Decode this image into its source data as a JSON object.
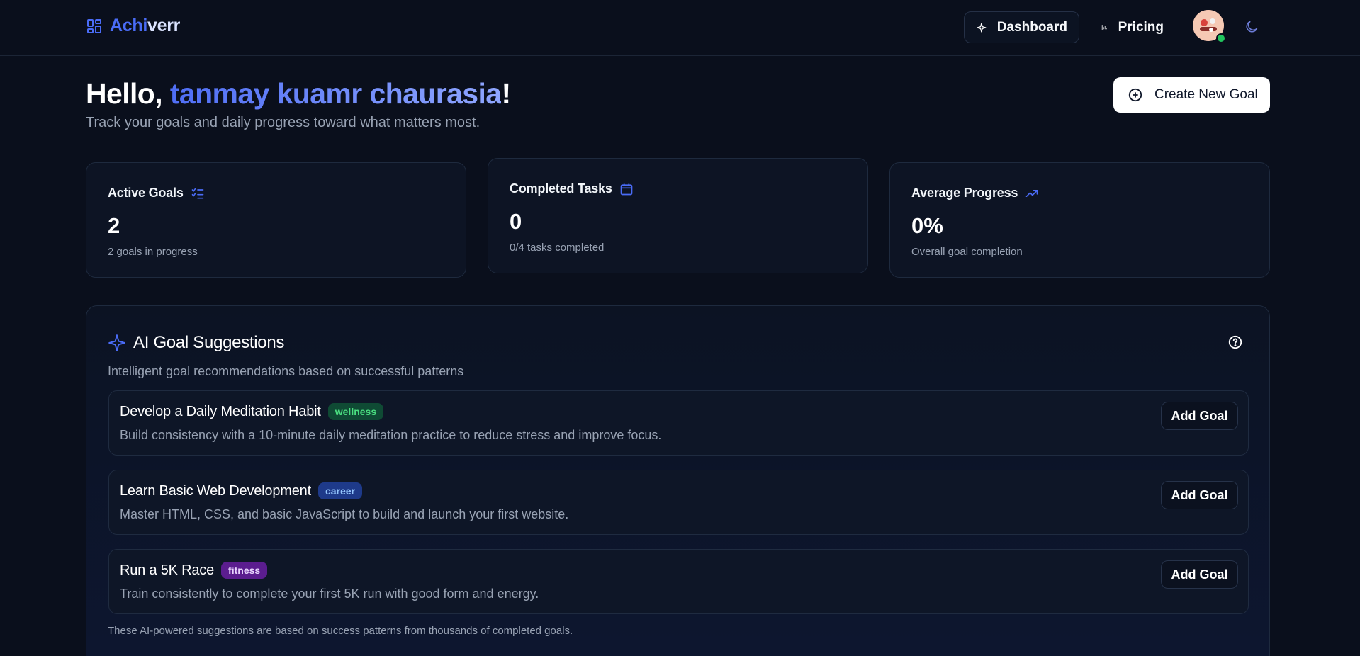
{
  "brand": {
    "name_part1": "Achi",
    "name_part2": "verr"
  },
  "nav": {
    "dashboard_label": "Dashboard",
    "pricing_label": "Pricing"
  },
  "icons": {
    "brand": "grid-layout-icon",
    "dashboard": "sparkle-icon",
    "pricing": "bar-chart-icon",
    "theme": "moon-icon",
    "create": "plus-circle-icon",
    "active_goals": "list-checks-icon",
    "completed_tasks": "calendar-icon",
    "average_progress": "trending-up-icon",
    "ai": "sparkle-icon",
    "help": "help-circle-icon"
  },
  "greeting": {
    "prefix": "Hello, ",
    "name": "tanmay kuamr chaurasia",
    "suffix": "!"
  },
  "subtitle": "Track your goals and daily progress toward what matters most.",
  "create_button_label": "Create New Goal",
  "stats": [
    {
      "title": "Active Goals",
      "value": "2",
      "desc": "2 goals in progress"
    },
    {
      "title": "Completed Tasks",
      "value": "0",
      "desc": "0/4 tasks completed"
    },
    {
      "title": "Average Progress",
      "value": "0%",
      "desc": "Overall goal completion"
    }
  ],
  "ai": {
    "title": "AI Goal Suggestions",
    "subtitle": "Intelligent goal recommendations based on successful patterns",
    "footer": "These AI-powered suggestions are based on success patterns from thousands of completed goals.",
    "suggestions": [
      {
        "title": "Develop a Daily Meditation Habit",
        "tag": "wellness",
        "desc": "Build consistency with a 10-minute daily meditation practice to reduce stress and improve focus.",
        "button": "Add Goal"
      },
      {
        "title": "Learn Basic Web Development",
        "tag": "career",
        "desc": "Master HTML, CSS, and basic JavaScript to build and launch your first website.",
        "button": "Add Goal"
      },
      {
        "title": "Run a 5K Race",
        "tag": "fitness",
        "desc": "Train consistently to complete your first 5K run with good form and energy.",
        "button": "Add Goal"
      }
    ]
  },
  "colors": {
    "background": "#0a0f1c",
    "accent": "#4a6cf7",
    "wellness": "#4ade80",
    "career": "#93c5fd",
    "fitness": "#e9d5ff",
    "online": "#22c55e"
  }
}
